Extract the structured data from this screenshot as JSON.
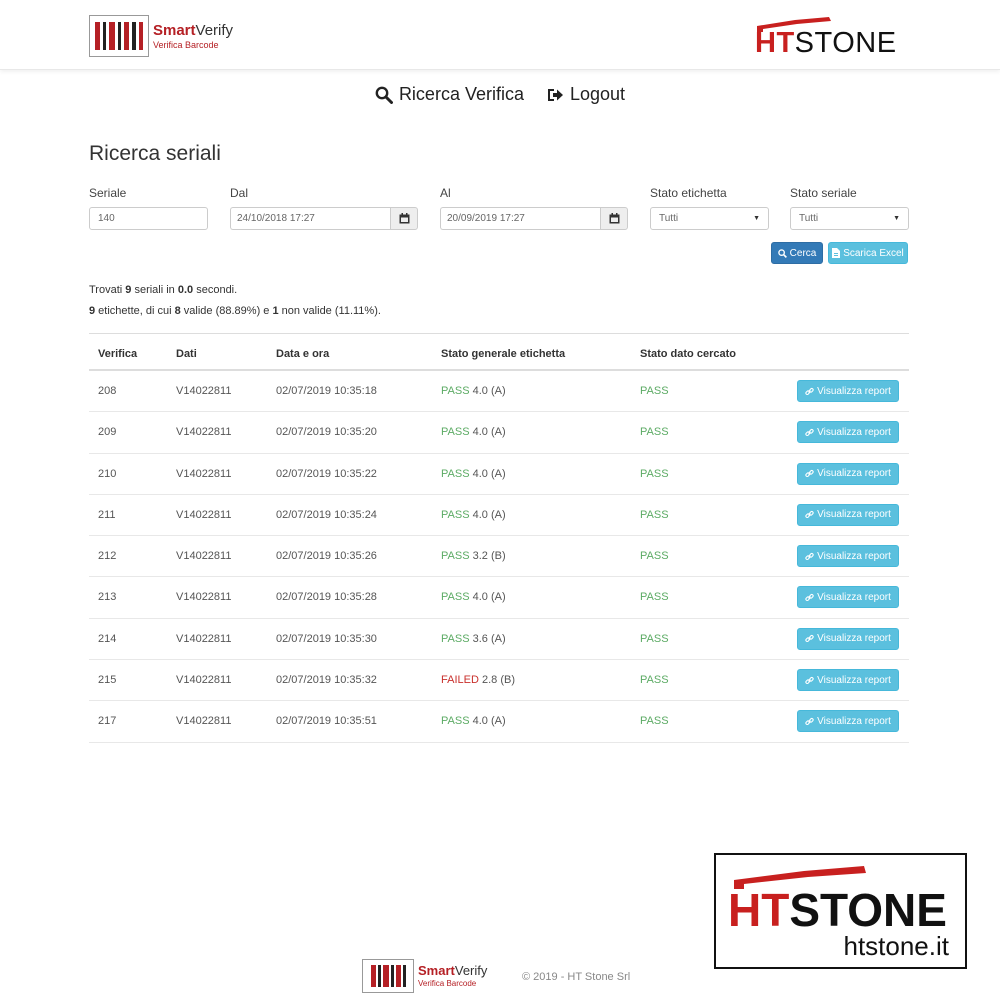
{
  "header": {
    "app_name_bold": "Smart",
    "app_name_light": "Verify",
    "app_subtitle": "Verifica Barcode",
    "brand_red": "HT",
    "brand_black": "STONE"
  },
  "nav": {
    "search_label": "Ricerca Verifica",
    "logout_label": "Logout"
  },
  "page": {
    "title": "Ricerca seriali"
  },
  "form": {
    "seriale_label": "Seriale",
    "seriale_value": "140",
    "dal_label": "Dal",
    "dal_value": "24/10/2018 17:27",
    "al_label": "Al",
    "al_value": "20/09/2019 17:27",
    "stato_etichetta_label": "Stato etichetta",
    "stato_etichetta_value": "Tutti",
    "stato_seriale_label": "Stato seriale",
    "stato_seriale_value": "Tutti",
    "cerca_label": "Cerca",
    "excel_label": "Scarica Excel"
  },
  "summary": {
    "line1_a": "Trovati ",
    "line1_count": "9",
    "line1_b": " seriali in ",
    "line1_time": "0.0",
    "line1_c": " secondi.",
    "line2_count": "9",
    "line2_a": " etichette, di cui ",
    "line2_valid": "8",
    "line2_b": " valide (88.89%) e ",
    "line2_invalid": "1",
    "line2_c": " non valide (11.11%)."
  },
  "table": {
    "headers": [
      "Verifica",
      "Dati",
      "Data e ora",
      "Stato generale etichetta",
      "Stato dato cercato"
    ],
    "report_label": "Visualizza report",
    "rows": [
      {
        "verifica": "208",
        "dati": "V14022811",
        "data": "02/07/2019 10:35:18",
        "stato": "PASS",
        "grade": "4.0 (A)",
        "cercato": "PASS"
      },
      {
        "verifica": "209",
        "dati": "V14022811",
        "data": "02/07/2019 10:35:20",
        "stato": "PASS",
        "grade": "4.0 (A)",
        "cercato": "PASS"
      },
      {
        "verifica": "210",
        "dati": "V14022811",
        "data": "02/07/2019 10:35:22",
        "stato": "PASS",
        "grade": "4.0 (A)",
        "cercato": "PASS"
      },
      {
        "verifica": "211",
        "dati": "V14022811",
        "data": "02/07/2019 10:35:24",
        "stato": "PASS",
        "grade": "4.0 (A)",
        "cercato": "PASS"
      },
      {
        "verifica": "212",
        "dati": "V14022811",
        "data": "02/07/2019 10:35:26",
        "stato": "PASS",
        "grade": "3.2 (B)",
        "cercato": "PASS"
      },
      {
        "verifica": "213",
        "dati": "V14022811",
        "data": "02/07/2019 10:35:28",
        "stato": "PASS",
        "grade": "4.0 (A)",
        "cercato": "PASS"
      },
      {
        "verifica": "214",
        "dati": "V14022811",
        "data": "02/07/2019 10:35:30",
        "stato": "PASS",
        "grade": "3.6 (A)",
        "cercato": "PASS"
      },
      {
        "verifica": "215",
        "dati": "V14022811",
        "data": "02/07/2019 10:35:32",
        "stato": "FAILED",
        "grade": "2.8 (B)",
        "cercato": "PASS"
      },
      {
        "verifica": "217",
        "dati": "V14022811",
        "data": "02/07/2019 10:35:51",
        "stato": "PASS",
        "grade": "4.0 (A)",
        "cercato": "PASS"
      }
    ]
  },
  "footer": {
    "copyright": "© 2019 - HT Stone Srl"
  },
  "watermark": {
    "brand_red": "HT",
    "brand_black": "STONE",
    "url": "htstone.it"
  },
  "colors": {
    "brand_red": "#c8201f",
    "primary_button": "#337ab7",
    "info_button": "#5bc0de",
    "pass_green": "#5cab64",
    "fail_red": "#c9302c"
  },
  "icons": {
    "search": "search-icon",
    "logout": "logout-icon",
    "calendar": "calendar-icon",
    "excel": "file-icon",
    "report": "link-icon"
  }
}
